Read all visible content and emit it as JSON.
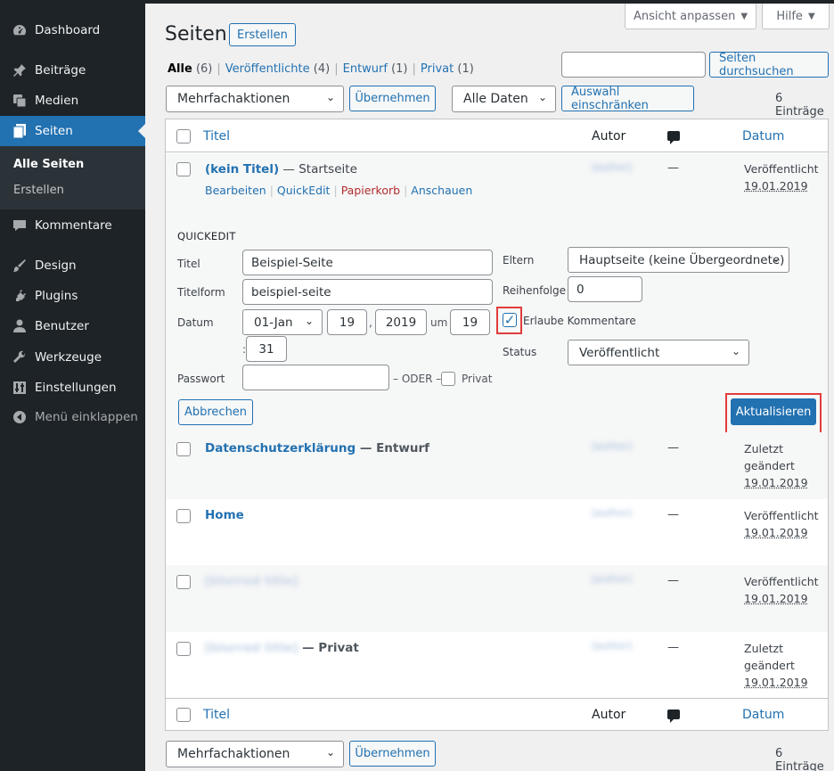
{
  "sidebar": {
    "items": [
      {
        "label": "Dashboard",
        "icon": "dashboard-icon"
      },
      {
        "label": "Beiträge",
        "icon": "pin-icon"
      },
      {
        "label": "Medien",
        "icon": "media-icon"
      },
      {
        "label": "Seiten",
        "icon": "pages-icon"
      },
      {
        "label": "Kommentare",
        "icon": "comments-icon"
      },
      {
        "label": "Design",
        "icon": "brush-icon"
      },
      {
        "label": "Plugins",
        "icon": "plugin-icon"
      },
      {
        "label": "Benutzer",
        "icon": "user-icon"
      },
      {
        "label": "Werkzeuge",
        "icon": "wrench-icon"
      },
      {
        "label": "Einstellungen",
        "icon": "settings-icon"
      },
      {
        "label": "Menü einklappen",
        "icon": "collapse-icon"
      }
    ],
    "submenu": {
      "current": "Alle Seiten",
      "other": "Erstellen"
    }
  },
  "screen_options": {
    "view": "Ansicht anpassen",
    "help": "Hilfe"
  },
  "header": {
    "title": "Seiten",
    "add_new": "Erstellen"
  },
  "filters": {
    "views": [
      {
        "label": "Alle",
        "count": "(6)"
      },
      {
        "label": "Veröffentlichte",
        "count": "(4)"
      },
      {
        "label": "Entwurf",
        "count": "(1)"
      },
      {
        "label": "Privat",
        "count": "(1)"
      }
    ],
    "search_button": "Seiten durchsuchen",
    "bulk_action": "Mehrfachaktionen",
    "apply": "Übernehmen",
    "dates": "Alle Daten",
    "filter_button": "Auswahl einschränken",
    "items_count": "6 Einträge"
  },
  "table": {
    "columns": {
      "title": "Titel",
      "author": "Autor",
      "date": "Datum"
    },
    "rows": [
      {
        "title": "(kein Titel)",
        "state": " — Startseite",
        "date_status": "Veröffentlicht",
        "date": "19.01.2019",
        "author": "[author]"
      },
      {
        "title": "Datenschutzerklärung",
        "state": " — Entwurf",
        "date_status": "Zuletzt geändert",
        "date": "19.01.2019",
        "author": "[author]"
      },
      {
        "title": "Home",
        "state": "",
        "date_status": "Veröffentlicht",
        "date": "19.01.2019",
        "author": "[author]"
      },
      {
        "title": "[blurred title]",
        "state": "",
        "date_status": "Veröffentlicht",
        "date": "19.01.2019",
        "author": "[author]"
      },
      {
        "title": "[blurred title]",
        "state": " — Privat",
        "date_status": "Zuletzt geändert",
        "date": "19.01.2019",
        "author": "[author]"
      }
    ],
    "row_actions": {
      "edit": "Bearbeiten",
      "quick_edit": "QuickEdit",
      "trash": "Papierkorb",
      "view": "Anschauen"
    },
    "dash": "—"
  },
  "quick_edit": {
    "heading": "QUICKEDIT",
    "title_label": "Titel",
    "title_value": "Beispiel-Seite",
    "slug_label": "Titelform",
    "slug_value": "beispiel-seite",
    "date_label": "Datum",
    "month": "01-Jan",
    "day": "19",
    "year": "2019",
    "at": "um",
    "hour": "19",
    "minute": "31",
    "comma": ",",
    "colon": ":",
    "password_label": "Passwort",
    "or_text": "– ODER –",
    "private_label": "Privat",
    "parent_label": "Eltern",
    "parent_value": "Hauptseite (keine Übergeordnete)",
    "order_label": "Reihenfolge",
    "order_value": "0",
    "comments_label": "Erlaube Kommentare",
    "status_label": "Status",
    "status_value": "Veröffentlicht",
    "cancel": "Abbrechen",
    "update": "Aktualisieren"
  },
  "colors": {
    "accent": "#2271b1",
    "sidebar": "#1d2327",
    "highlight": "#e23c3c"
  }
}
